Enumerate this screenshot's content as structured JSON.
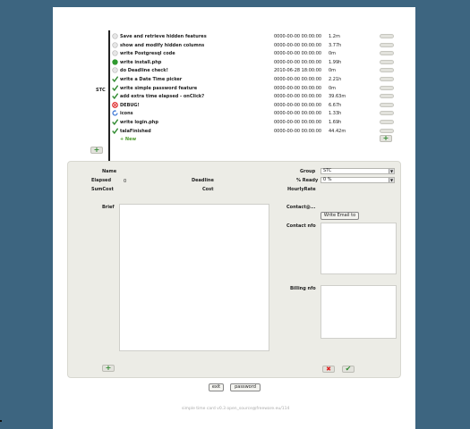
{
  "project": {
    "label": "STC"
  },
  "tasks": [
    {
      "name": "Save and retrieve hidden features",
      "deadline": "0000-00-00 00:00:00",
      "elapsed": "1.2m",
      "status": "empty"
    },
    {
      "name": "show and modify hidden columns",
      "deadline": "0000-00-00 00:00:00",
      "elapsed": "3.77h",
      "status": "empty"
    },
    {
      "name": "write Postgresql code",
      "deadline": "0000-00-00 00:00:00",
      "elapsed": "0m",
      "status": "empty"
    },
    {
      "name": "write install.php",
      "deadline": "0000-00-00 00:00:00",
      "elapsed": "1.99h",
      "status": "active"
    },
    {
      "name": "do Deadline check!",
      "deadline": "2010-06-28 18:00:00",
      "elapsed": "0m",
      "status": "empty"
    },
    {
      "name": "write a Date Time picker",
      "deadline": "0000-00-00 00:00:00",
      "elapsed": "2.21h",
      "status": "done"
    },
    {
      "name": "write simple password feature",
      "deadline": "0000-00-00 00:00:00",
      "elapsed": "0m",
      "status": "done"
    },
    {
      "name": "add extra time elapsed - onClick?",
      "deadline": "0000-00-00 00:00:00",
      "elapsed": "39.63m",
      "status": "done"
    },
    {
      "name": "DEBUG!",
      "deadline": "0000-00-00 00:00:00",
      "elapsed": "6.67h",
      "status": "debug"
    },
    {
      "name": "icons",
      "deadline": "0000-00-00 00:00:00",
      "elapsed": "1.33h",
      "status": "refresh"
    },
    {
      "name": "write login.php",
      "deadline": "0000-00-00 00:00:00",
      "elapsed": "1.69h",
      "status": "done"
    },
    {
      "name": "talaFinished",
      "deadline": "0000-00-00 00:00:00",
      "elapsed": "44.42m",
      "status": "done"
    }
  ],
  "new_row": {
    "label": "+ New",
    "add_symbol": "+"
  },
  "add_under": {
    "symbol": "+"
  },
  "detail": {
    "name_label": "Name",
    "elapsed_label": "Elapsed",
    "elapsed_value": "0",
    "deadline_label": "Deadline",
    "sumcost_label": "SumCost",
    "cost_label": "Cost",
    "group_label": "Group",
    "group_value": "STC",
    "ready_label": "% Ready",
    "ready_value": "0 %",
    "hourlyrate_label": "HourlyRate",
    "brief_label": "Brief",
    "contact_at_label": "Contact@...",
    "write_email_label": "Write Email to",
    "contact_info_label": "Contact nfo",
    "billing_info_label": "Billing nfo",
    "add_symbol": "+",
    "cancel_symbol": "✖",
    "ok_symbol": "✔"
  },
  "footer": {
    "exit_label": "exit",
    "password_label": "password",
    "note": "simple time card v0.3 open_source@freeware.eu/114"
  },
  "colors": {
    "background": "#3d6580",
    "panel": "#ecece6",
    "green": "#2f8a2f",
    "red": "#d22222"
  }
}
